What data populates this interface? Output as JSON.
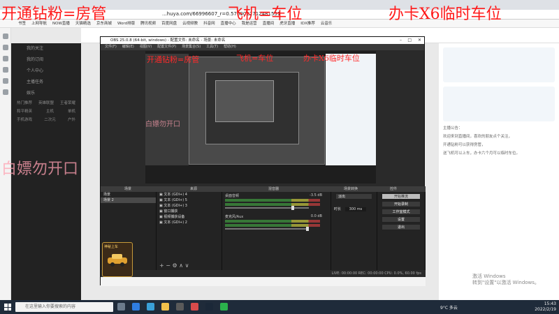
{
  "browser": {
    "url": "...huya.com/66996607_r=0.5760022712481551",
    "bookmarks": [
      "书签",
      "上网导航",
      "NOW直播",
      "天猫精选",
      "京东商城",
      "Word排版",
      "腾讯视频",
      "百度网盘",
      "云视频教",
      "抖音网",
      "直播中心",
      "我是运营",
      "直播间",
      "虎牙直播",
      "IDX推荐",
      "云音乐"
    ]
  },
  "overlay": {
    "line1": "开通钻粉=房管",
    "line2": "飞机=车位",
    "line3": "办卡X6临时车位",
    "line4": "白嫖勿开口"
  },
  "obs": {
    "title": "OBS 25.0.8 (64-bit, windows) - 配置文件: 未命名 - 场景: 未命名",
    "menu": [
      "文件(F)",
      "编辑(E)",
      "视图(V)",
      "配置文件(P)",
      "场景集合(S)",
      "工具(T)",
      "帮助(H)"
    ],
    "docks": {
      "scenes_header": "场景",
      "sources_header": "来源",
      "mixer_header": "混音器",
      "transition_header": "场景转换",
      "controls_header": "控件"
    },
    "scenes": [
      "场景",
      "场景 2"
    ],
    "sources": [
      "文本 (GDI+) 4",
      "文本 (GDI+) 5",
      "文本 (GDI+) 3",
      "窗口捕获",
      "视频捕获设备",
      "文本 (GDI+) 2"
    ],
    "mixer": [
      {
        "name": "桌面音频",
        "db": "-3.5 dB",
        "level": 0.82
      },
      {
        "name": "麦克风/Aux",
        "db": "0.0 dB",
        "level": 1.0
      }
    ],
    "transition": {
      "type": "淡出",
      "duration_label": "时长",
      "duration": "300 ms"
    },
    "controls": [
      "开始推流",
      "开始录制",
      "工作室模式",
      "设置",
      "退出"
    ],
    "status": "LIVE: 00:00:00   REC: 00:00:00   CPU: 0.0%, 60.00 fps"
  },
  "site": {
    "nav": [
      "我的关注",
      "我的订阅",
      "个人中心",
      "主播任务",
      "娱乐"
    ],
    "grid": [
      [
        "热门推荐",
        "英雄联盟",
        "王者荣耀"
      ],
      [
        "和平精英",
        "主机",
        "单机"
      ],
      [
        "手机游戏",
        "二次元",
        "户外"
      ]
    ],
    "right_text": [
      "主播公告：",
      "欢迎来到直播间，喜欢的朋友点个关注，",
      "开通钻粉可以获得房管，",
      "送飞机可以上车，办卡六个月可以临时车位。"
    ],
    "activate_line1": "激活 Windows",
    "activate_line2": "转到\"设置\"以激活 Windows。"
  },
  "gift": {
    "label": "神秘上车",
    "icon": "car-icon"
  },
  "taskbar": {
    "search_placeholder": "在这里输入你要搜索的内容",
    "weather": "9°C 多云",
    "time": "15:43",
    "date": "2022/2/19",
    "icons": [
      "task-view-icon",
      "edge-icon",
      "search-app-icon",
      "explorer-icon",
      "obs-icon",
      "media-icon",
      "steam-icon",
      "wechat-icon"
    ]
  }
}
